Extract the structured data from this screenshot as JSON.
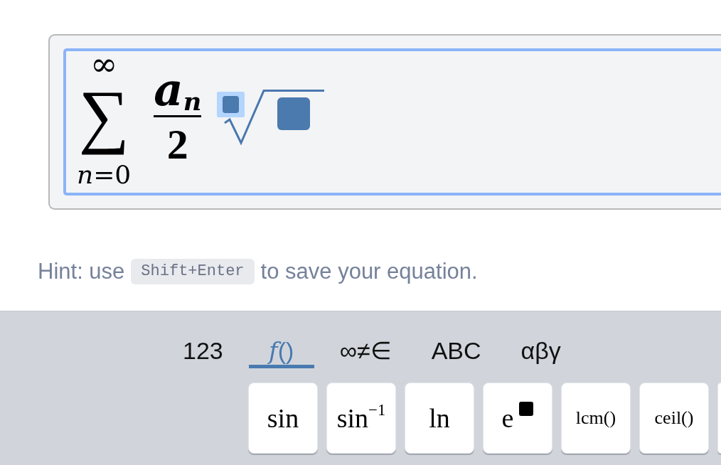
{
  "math_field": {
    "focused": true,
    "terms": [
      {
        "kind": "sum",
        "symbol": "∑",
        "upper": "∞",
        "lower": "*n*=0"
      },
      {
        "kind": "fraction",
        "numerator": "a",
        "numerator_subscript": "n",
        "denominator": "2"
      },
      {
        "kind": "root",
        "index": {
          "selected": true
        },
        "radicand": {
          "selected": false
        }
      }
    ]
  },
  "hint": {
    "before": "Hint: use",
    "shortcut": "Shift+Enter",
    "after": "to save your equation."
  },
  "keyboard": {
    "tabs": [
      {
        "label": "123",
        "selected": false
      },
      {
        "label": "*f*()",
        "selected": true
      },
      {
        "label": "∞≠∈",
        "selected": false
      },
      {
        "label": "ABC",
        "selected": false
      },
      {
        "label": "αβγ",
        "selected": false
      }
    ],
    "keys": [
      {
        "kind": "function",
        "label": "sin"
      },
      {
        "kind": "function",
        "label": "sin$^{−1}$"
      },
      {
        "kind": "function",
        "label": "ln"
      },
      {
        "kind": "exponent",
        "label": "e"
      },
      {
        "kind": "command",
        "label": "lcm()"
      },
      {
        "kind": "command",
        "label": "ceil()"
      }
    ]
  }
}
